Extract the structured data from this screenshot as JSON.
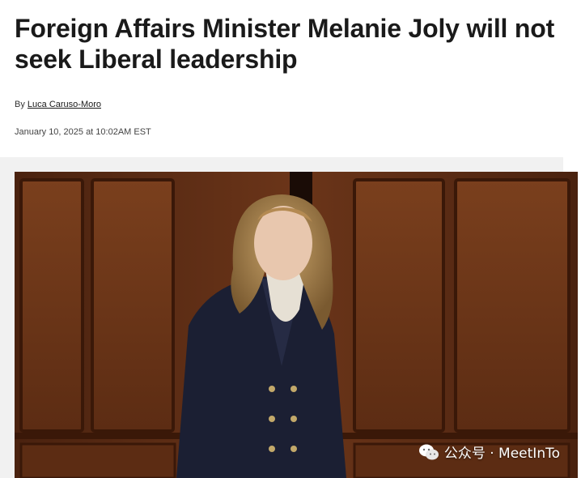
{
  "article": {
    "headline": "Foreign Affairs Minister Melanie Joly will not seek Liberal leadership",
    "byline_prefix": "By",
    "author": "Luca Caruso-Moro",
    "date": "January 10, 2025 at 10:02AM EST"
  },
  "photo": {
    "watermark_text": "公众号 · MeetInTo",
    "watermark_icon": "wechat-icon"
  },
  "colors": {
    "text": "#1a1a1a",
    "photo_bg": "#5a2d16",
    "frame_bg": "#f1f1f1"
  }
}
